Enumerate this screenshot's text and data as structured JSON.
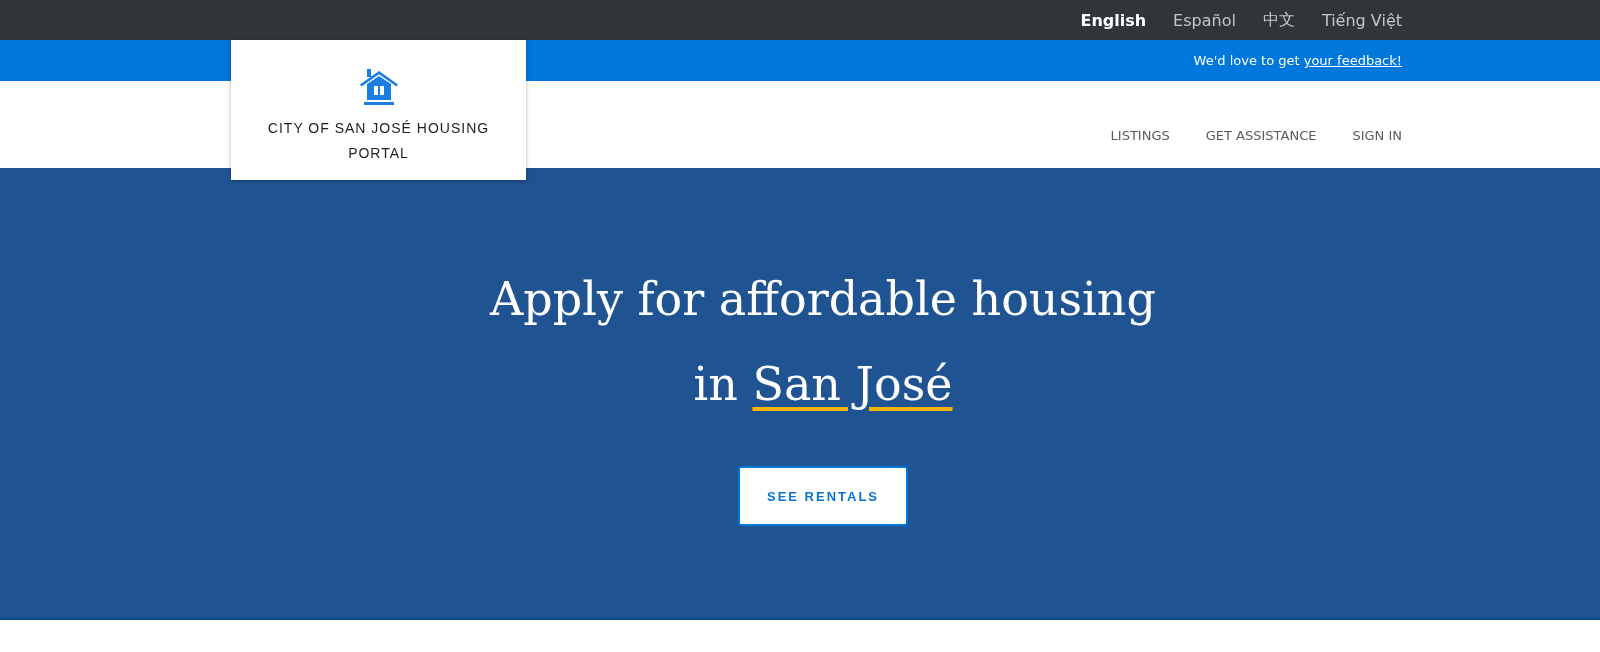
{
  "language_bar": {
    "languages": [
      {
        "label": "English",
        "selected": true
      },
      {
        "label": "Español",
        "selected": false
      },
      {
        "label": "中文",
        "selected": false
      },
      {
        "label": "Tiếng Việt",
        "selected": false
      }
    ]
  },
  "feedback_bar": {
    "text": "We'd love to get",
    "link": "your feedback!"
  },
  "header": {
    "logo_title": "CITY OF SAN JOSÉ HOUSING PORTAL",
    "nav": [
      "LISTINGS",
      "GET ASSISTANCE",
      "SIGN IN"
    ]
  },
  "hero": {
    "title_line_1": "Apply for affordable housing",
    "title_line_2": "in",
    "title_highlight": "San José",
    "button": "SEE RENTALS"
  }
}
